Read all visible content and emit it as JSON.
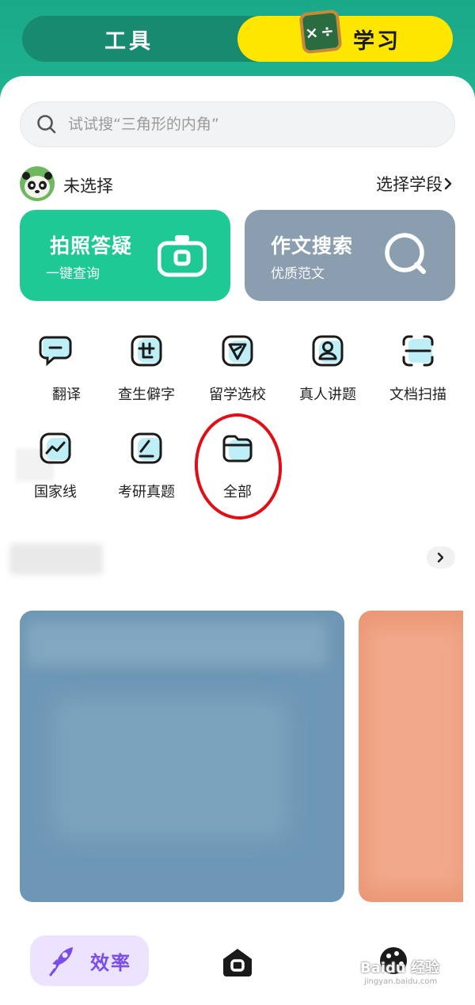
{
  "header": {
    "tab_tool": "工具",
    "tab_study": "学习",
    "board_symbol": "×÷"
  },
  "search": {
    "placeholder": "试试搜“三角形的内角”"
  },
  "stage": {
    "current": "未选择",
    "select_label": "选择学段"
  },
  "cards": [
    {
      "title": "拍照答疑",
      "subtitle": "一键查询",
      "icon": "camera-icon",
      "color": "#1fc995"
    },
    {
      "title": "作文搜索",
      "subtitle": "优质范文",
      "icon": "search-icon",
      "color": "#8a9eaf"
    }
  ],
  "tools": [
    {
      "label": "翻译",
      "icon": "chat-bubble-icon"
    },
    {
      "label": "查生僻字",
      "icon": "char-lookup-icon"
    },
    {
      "label": "留学选校",
      "icon": "send-plane-icon"
    },
    {
      "label": "真人讲题",
      "icon": "person-icon"
    },
    {
      "label": "文档扫描",
      "icon": "scan-icon"
    },
    {
      "label": "国家线",
      "icon": "trend-line-icon"
    },
    {
      "label": "考研真题",
      "icon": "edit-note-icon"
    },
    {
      "label": "全部",
      "icon": "folder-icon"
    }
  ],
  "bottom_nav": {
    "efficiency": "效率",
    "watermark": "Baidu 经验",
    "watermark_sub": "jingyan.baidu.com"
  },
  "colors": {
    "accent_green": "#1fc995",
    "header_green": "#1aa889",
    "study_yellow": "#ffe600",
    "tool_icon_accent": "#8fe6f2",
    "highlight_circle": "#e10e16",
    "nav_purple": "#7b4de8"
  }
}
